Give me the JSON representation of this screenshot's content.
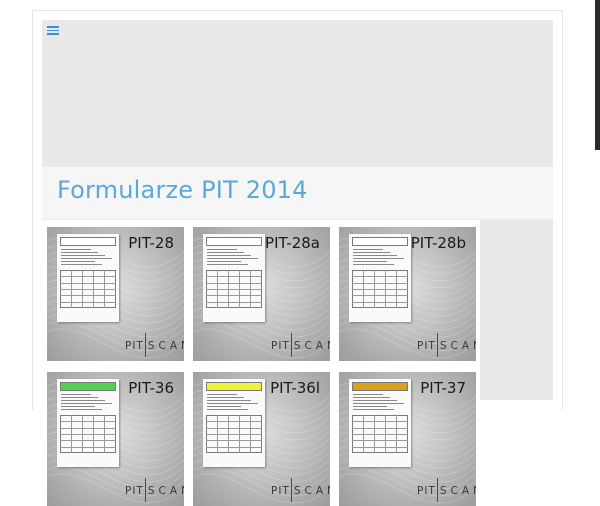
{
  "header": {
    "menu_icon": "hamburger-menu-icon",
    "title": "Formularze PIT 2014"
  },
  "forms": [
    {
      "label": "PIT-28",
      "brand_left": "PIT",
      "brand_right": "SCAN",
      "header_color": "#ffffff"
    },
    {
      "label": "PIT-28a",
      "brand_left": "PIT",
      "brand_right": "SCAN",
      "header_color": "#ffffff"
    },
    {
      "label": "PIT-28b",
      "brand_left": "PIT",
      "brand_right": "SCAN",
      "header_color": "#ffffff"
    },
    {
      "label": "PIT-36",
      "brand_left": "PIT",
      "brand_right": "SCAN",
      "header_color": "#4fd34f"
    },
    {
      "label": "PIT-36l",
      "brand_left": "PIT",
      "brand_right": "SCAN",
      "header_color": "#f2f23a"
    },
    {
      "label": "PIT-37",
      "brand_left": "PIT",
      "brand_right": "SCAN",
      "header_color": "#d9a21a"
    }
  ],
  "colors": {
    "title": "#5aa8dc",
    "menu_icon": "#3a8fd6",
    "panel_background": "#e9e9e9"
  }
}
